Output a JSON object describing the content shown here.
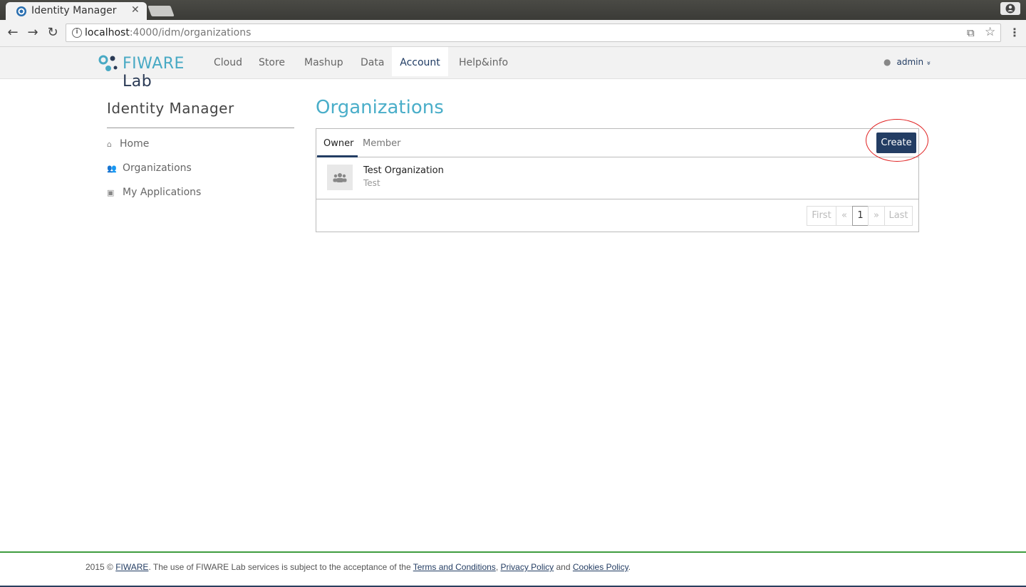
{
  "browser": {
    "tab_title": "Identity Manager",
    "tab_close": "✕",
    "url_host": "localhost",
    "url_path": ":4000/idm/organizations",
    "back_glyph": "←",
    "forward_glyph": "→",
    "reload_glyph": "↻",
    "menu_glyph": "⋮",
    "star_glyph": "☆",
    "translate_glyph": "⧉"
  },
  "navbar": {
    "logo_fiware": "FIWARE",
    "logo_lab": "Lab",
    "items": [
      "Cloud",
      "Store",
      "Mashup",
      "Data",
      "Account",
      "Help&info"
    ],
    "active_item": "Account",
    "user": "admin",
    "user_chevron": "»"
  },
  "sidebar": {
    "title": "Identity Manager",
    "items": [
      {
        "label": "Home",
        "icon": "home-icon",
        "glyph": "⌂"
      },
      {
        "label": "Organizations",
        "icon": "users-icon",
        "glyph": "👥"
      },
      {
        "label": "My Applications",
        "icon": "cube-icon",
        "glyph": "▣"
      }
    ]
  },
  "main": {
    "title": "Organizations",
    "tabs": [
      "Owner",
      "Member"
    ],
    "active_tab": "Owner",
    "create_label": "Create",
    "organizations": [
      {
        "name": "Test Organization",
        "description": "Test"
      }
    ],
    "pager": [
      "First",
      "«",
      "1",
      "»",
      "Last"
    ],
    "current_page": "1"
  },
  "footer": {
    "prefix": "2015 © ",
    "fiware_link": "FIWARE",
    "middle": ". The use of FIWARE Lab services is subject to the acceptance of the ",
    "terms_link": "Terms and Conditions",
    "sep": ", ",
    "privacy_link": "Privacy Policy",
    "and": " and ",
    "cookies_link": "Cookies Policy",
    "end": "."
  },
  "colors": {
    "brand_blue": "#233d63",
    "accent_cyan": "#4aaec9",
    "footer_green": "#3e9c3e",
    "highlight_red": "#e02020"
  }
}
